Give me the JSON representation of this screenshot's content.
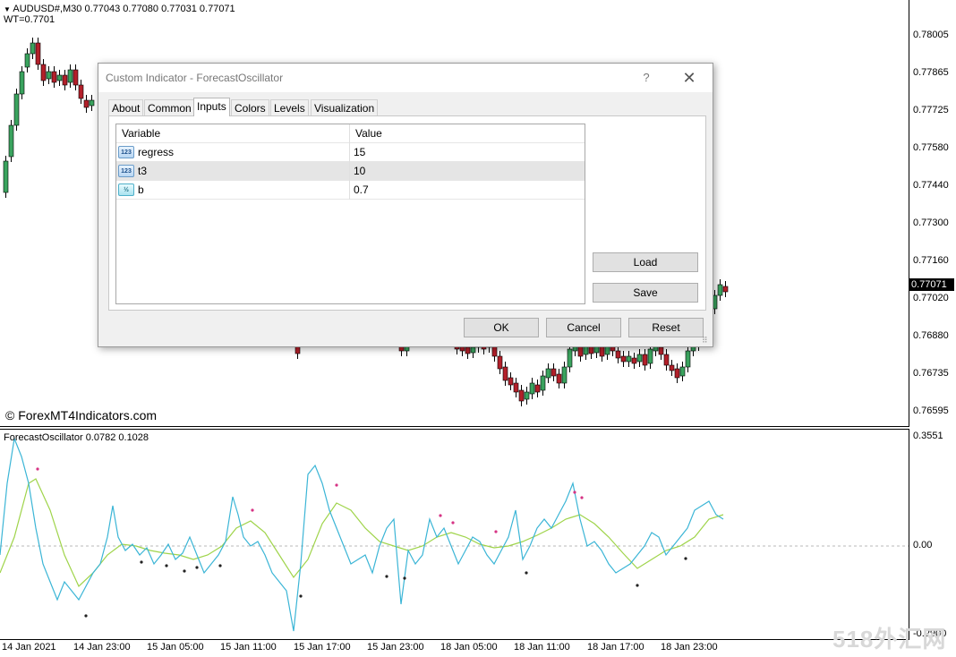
{
  "chart": {
    "main_header": "AUDUSD#,M30  0.77043 0.77080 0.77031 0.77071",
    "main_subheader": "WT=0.7701",
    "copyright": "© ForexMT4Indicators.com",
    "price_labels": [
      "0.78005",
      "0.77865",
      "0.77725",
      "0.77580",
      "0.77440",
      "0.77300",
      "0.77160",
      "0.77020",
      "0.76880",
      "0.76735",
      "0.76595"
    ],
    "current_price": "0.77071",
    "osc_header": "ForecastOscillator 0.0782 0.1028",
    "osc_labels": [
      "0.3551",
      "0.00",
      "-0.2900"
    ],
    "time_labels": [
      "14 Jan 2021",
      "14 Jan 23:00",
      "15 Jan 05:00",
      "15 Jan 11:00",
      "15 Jan 17:00",
      "15 Jan 23:00",
      "18 Jan 05:00",
      "18 Jan 11:00",
      "18 Jan 17:00",
      "18 Jan 23:00"
    ],
    "bull_color": "#3aa35e",
    "bear_color": "#b3202a",
    "osc_line_color": "#3bb5d6",
    "signal_line_color": "#9fd44a"
  },
  "dialog": {
    "title": "Custom Indicator - ForecastOscillator",
    "help_glyph": "?",
    "close_glyph": "✕",
    "tabs": [
      {
        "label": "About"
      },
      {
        "label": "Common"
      },
      {
        "label": "Inputs"
      },
      {
        "label": "Colors"
      },
      {
        "label": "Levels"
      },
      {
        "label": "Visualization"
      }
    ],
    "active_tab": "Inputs",
    "table": {
      "headers": [
        "Variable",
        "Value"
      ],
      "rows": [
        {
          "icon": "123",
          "variable": "regress",
          "value": "15"
        },
        {
          "icon": "123",
          "variable": "t3",
          "value": "10"
        },
        {
          "icon": "½",
          "variable": "b",
          "value": "0.7"
        }
      ]
    },
    "load_label": "Load",
    "save_label": "Save",
    "ok_label": "OK",
    "cancel_label": "Cancel",
    "reset_label": "Reset",
    "grip_glyph": "⠿"
  },
  "watermark": "518外汇网"
}
